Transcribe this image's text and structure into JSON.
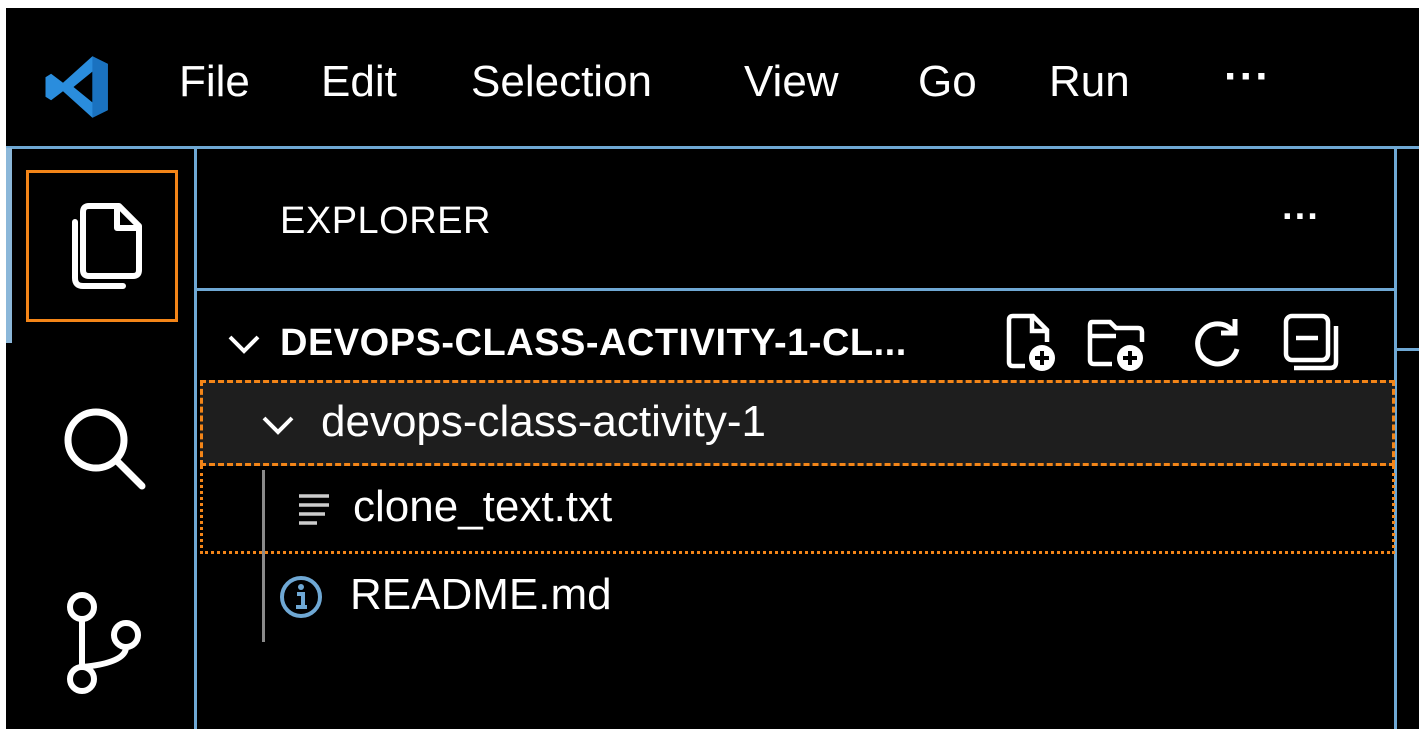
{
  "menu": {
    "items": [
      "File",
      "Edit",
      "Selection",
      "View",
      "Go",
      "Run"
    ],
    "more": "···"
  },
  "activity_bar": {
    "items": [
      {
        "icon": "explorer-icon",
        "active": true
      },
      {
        "icon": "search-icon",
        "active": false
      },
      {
        "icon": "source-control-icon",
        "active": false
      }
    ]
  },
  "explorer": {
    "title": "EXPLORER",
    "more": "···",
    "section": {
      "title": "DEVOPS-CLASS-ACTIVITY-1-CL...",
      "actions": [
        "new-file-icon",
        "new-folder-icon",
        "refresh-icon",
        "collapse-all-icon"
      ]
    },
    "tree": {
      "folder": "devops-class-activity-1",
      "files": [
        {
          "name": "clone_text.txt",
          "icon": "text-file-icon"
        },
        {
          "name": "README.md",
          "icon": "info-icon"
        }
      ]
    }
  },
  "colors": {
    "background": "#000000",
    "border": "#6fa8d4",
    "focus": "#f38518",
    "vscode_blue": "#2a8ddd"
  }
}
